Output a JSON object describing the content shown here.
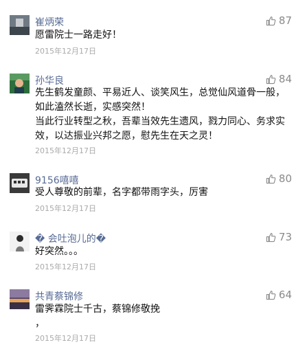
{
  "comments": [
    {
      "name": "崔炳荣",
      "likes": "87",
      "lines": [
        "愿雷院士一路走好！"
      ],
      "date": "2015年12月17日"
    },
    {
      "name": "孙华良",
      "likes": "84",
      "lines": [
        "先生鹤发童颜、平易近人、谈笑风生，总觉仙风道骨一般，",
        "如此溘然长逝，实感突然！",
        "当此行业转型之秋，吾辈当效先生遗风，戮力同心、务求实",
        "效，以达振业兴邦之愿，慰先生在天之灵！"
      ],
      "date": "2015年12月17日"
    },
    {
      "name": "9156嘻嘻",
      "likes": "80",
      "lines": [
        "受人尊敬的前辈，名字都带雨字头，厉害"
      ],
      "date": "2015年12月17日"
    },
    {
      "name": "� 会吐泡儿的�",
      "likes": "73",
      "lines": [
        "好突然。。。"
      ],
      "date": "2015年12月17日"
    },
    {
      "name": "共青蔡锦修",
      "likes": "64",
      "lines": [
        "雷霁霖院士千古，蔡锦修敬挽",
        "，"
      ],
      "date": "2015年12月17日"
    }
  ],
  "colors": {
    "name": "#576b95",
    "date": "#aaaaaa",
    "like": "#8a8a8a"
  },
  "icons": {
    "like": "thumbs-up-icon"
  }
}
